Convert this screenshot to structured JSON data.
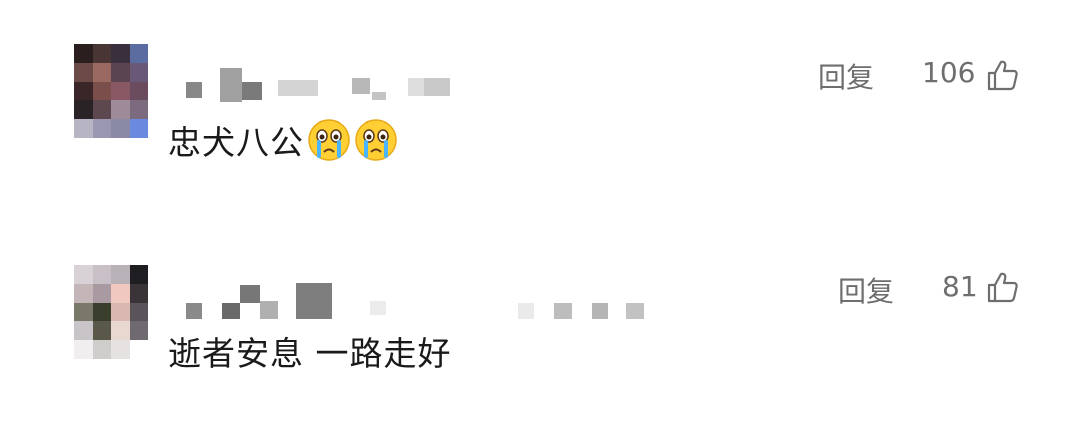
{
  "comments": [
    {
      "text": "忠犬八公",
      "emojis": [
        "crying-face-icon",
        "crying-face-icon"
      ],
      "reply_label": "回复",
      "likes": "106",
      "avatar_colors": [
        "#2b1e1e",
        "#4a3535",
        "#3a2f3c",
        "#5a6ca0",
        "#6b4a48",
        "#9a6a62",
        "#5a4450",
        "#6a5878",
        "#3a2528",
        "#7a4e4a",
        "#8a5864",
        "#6a4c5e",
        "#2a2326",
        "#5e4850",
        "#9e8a98",
        "#7c6a7e",
        "#b7b4c4",
        "#9a98b0",
        "#8a8aa6",
        "#6a8ae0"
      ]
    },
    {
      "text": "逝者安息 一路走好",
      "emojis": [],
      "reply_label": "回复",
      "likes": "81",
      "avatar_colors": [
        "#d8d2d6",
        "#c8c0c6",
        "#b8b2b8",
        "#1e1e22",
        "#c4b6b8",
        "#a89aa0",
        "#f0c8c0",
        "#3a3438",
        "#7a7868",
        "#3a3e2c",
        "#d8b8b0",
        "#5a545a",
        "#c8c4c8",
        "#5a5848",
        "#e8d8d0",
        "#6e6a70",
        "#f0eeee",
        "#cfcccc",
        "#e6e2e2",
        "#ffffff"
      ]
    }
  ]
}
